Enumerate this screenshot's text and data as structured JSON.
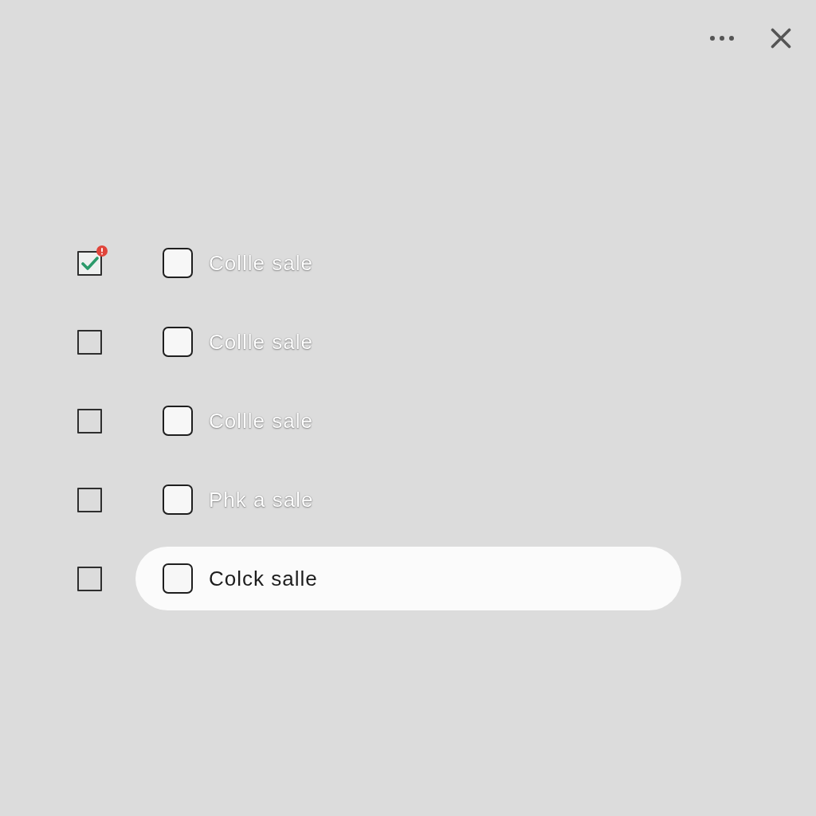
{
  "items": [
    {
      "checked": true,
      "alert": true,
      "inner_checked": false,
      "label": "Collle sale",
      "selected": false
    },
    {
      "checked": false,
      "alert": false,
      "inner_checked": false,
      "label": "Collle sale",
      "selected": false
    },
    {
      "checked": false,
      "alert": false,
      "inner_checked": false,
      "label": "Collle sale",
      "selected": false
    },
    {
      "checked": false,
      "alert": false,
      "inner_checked": false,
      "label": "Phk a sale",
      "selected": false
    },
    {
      "checked": false,
      "alert": false,
      "inner_checked": false,
      "label": "Colck salle",
      "selected": true
    }
  ]
}
